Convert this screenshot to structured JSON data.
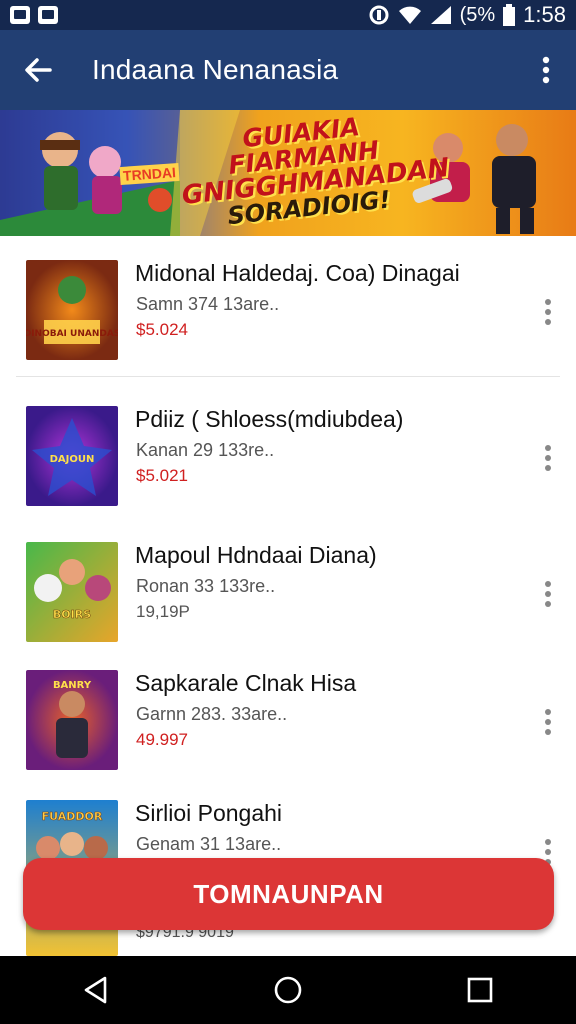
{
  "status_bar": {
    "battery": "(5%",
    "time": "1:58"
  },
  "app_bar": {
    "title": "Indaana Nenanasia"
  },
  "banner": {
    "line1": "GUIAKIA FIARMANH",
    "line2": "GNIGGHMANADAN",
    "line3": "SORADIOIG!",
    "side_label": "TRNDAI"
  },
  "items": [
    {
      "title": "Midonal Haldedaj. Coa) Dinagai",
      "subtitle": "Samn 374 13are..",
      "price": "$5.024",
      "price_style": "red",
      "thumb_text": "DINOBAI UNANDAS",
      "thumb_colors": [
        "#f28a1a",
        "#7b2a12"
      ]
    },
    {
      "title": "Pdiiz ( Shloess(mdiubdea)",
      "subtitle": "Kanan 29 133re..",
      "price": "$5.021",
      "price_style": "red",
      "thumb_text": "DAJOUN",
      "thumb_colors": [
        "#b134d9",
        "#3a1a8a"
      ]
    },
    {
      "title": "Mapoul Hdndaai Diana)",
      "subtitle": "Ronan 33 133re..",
      "price": "19,19P",
      "price_style": "gray",
      "thumb_text": "BOIRS",
      "thumb_colors": [
        "#48b84a",
        "#e8a52a"
      ]
    },
    {
      "title": "Sapkarale Clnak Hisa",
      "subtitle": "Garnn 283. 33are..",
      "price": "49.997",
      "price_style": "red",
      "thumb_text": "BANRY",
      "thumb_colors": [
        "#e8612a",
        "#6a1e7a"
      ]
    },
    {
      "title": "Sirlioi Pongahi",
      "subtitle": "Genam 31 13are..",
      "price": "$9791.9 9019",
      "price_style": "gray",
      "thumb_text": "FUADDOR",
      "thumb_colors": [
        "#1e7fd0",
        "#f2c233"
      ]
    }
  ],
  "cta": {
    "label": "TOMNAUNPAN"
  },
  "icons": {
    "back": "arrow-left-icon",
    "more": "more-vert-icon",
    "nav": [
      "nav-back-icon",
      "nav-home-icon",
      "nav-recents-icon"
    ]
  },
  "colors": {
    "status_bar": "#15284f",
    "app_bar": "#223f73",
    "accent": "#dc3636",
    "price": "#d02020"
  }
}
